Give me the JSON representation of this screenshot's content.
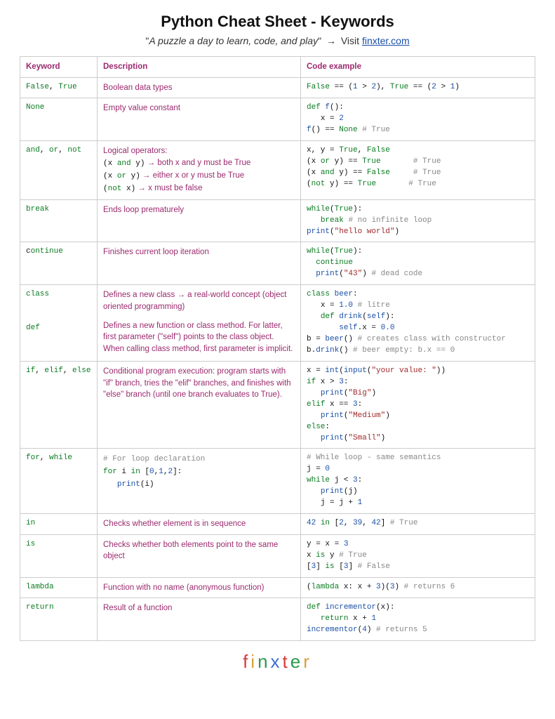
{
  "header": {
    "title": "Python Cheat Sheet - Keywords",
    "quote": "A puzzle a day to learn, code, and play",
    "visit_text": "Visit",
    "link_text": "finxter.com"
  },
  "table": {
    "columns": [
      "Keyword",
      "Description",
      "Code example"
    ]
  },
  "rows": [
    {
      "kw": [
        [
          "kw",
          "False"
        ],
        [
          "punc",
          ", "
        ],
        [
          "kw",
          "True"
        ]
      ],
      "desc": [
        {
          "t": "text",
          "v": "Boolean data types"
        }
      ],
      "code": [
        [
          "kw",
          "False"
        ],
        [
          "punc",
          " == ("
        ],
        [
          "num",
          "1"
        ],
        [
          "punc",
          " > "
        ],
        [
          "num",
          "2"
        ],
        [
          "punc",
          "), "
        ],
        [
          "kw",
          "True"
        ],
        [
          "punc",
          " == ("
        ],
        [
          "num",
          "2"
        ],
        [
          "punc",
          " > "
        ],
        [
          "num",
          "1"
        ],
        [
          "punc",
          ")"
        ]
      ]
    },
    {
      "kw": [
        [
          "kw",
          "None"
        ]
      ],
      "desc": [
        {
          "t": "text",
          "v": "Empty value constant"
        }
      ],
      "code": [
        [
          "kw",
          "def"
        ],
        [
          "punc",
          " "
        ],
        [
          "name",
          "f"
        ],
        [
          "punc",
          "():\n   x = "
        ],
        [
          "num",
          "2"
        ],
        [
          "punc",
          "\n"
        ],
        [
          "name",
          "f"
        ],
        [
          "punc",
          "() == "
        ],
        [
          "kw",
          "None"
        ],
        [
          "punc",
          " "
        ],
        [
          "cmt",
          "# True"
        ]
      ]
    },
    {
      "kw": [
        [
          "kw",
          "and"
        ],
        [
          "punc",
          ", "
        ],
        [
          "kw",
          "or"
        ],
        [
          "punc",
          ", "
        ],
        [
          "kw",
          "not"
        ]
      ],
      "desc": [
        {
          "t": "text",
          "v": "Logical operators:"
        },
        {
          "t": "br"
        },
        {
          "t": "code",
          "v": [
            [
              "punc",
              "(x "
            ],
            [
              "kw",
              "and"
            ],
            [
              "punc",
              " y)"
            ]
          ]
        },
        {
          "t": "text",
          "v": " → both x and y must be True"
        },
        {
          "t": "br"
        },
        {
          "t": "code",
          "v": [
            [
              "punc",
              "(x "
            ],
            [
              "kw",
              "or"
            ],
            [
              "punc",
              " y)"
            ]
          ]
        },
        {
          "t": "text",
          "v": " → either x or y must be True"
        },
        {
          "t": "br"
        },
        {
          "t": "code",
          "v": [
            [
              "punc",
              "("
            ],
            [
              "kw",
              "not"
            ],
            [
              "punc",
              " x)"
            ]
          ]
        },
        {
          "t": "text",
          "v": " → x must be false"
        }
      ],
      "code": [
        [
          "punc",
          "x, y = "
        ],
        [
          "kw",
          "True"
        ],
        [
          "punc",
          ", "
        ],
        [
          "kw",
          "False"
        ],
        [
          "punc",
          "\n(x "
        ],
        [
          "kw",
          "or"
        ],
        [
          "punc",
          " y) == "
        ],
        [
          "kw",
          "True"
        ],
        [
          "punc",
          "       "
        ],
        [
          "cmt",
          "# True"
        ],
        [
          "punc",
          "\n(x "
        ],
        [
          "kw",
          "and"
        ],
        [
          "punc",
          " y) == "
        ],
        [
          "kw",
          "False"
        ],
        [
          "punc",
          "     "
        ],
        [
          "cmt",
          "# True"
        ],
        [
          "punc",
          "\n("
        ],
        [
          "kw",
          "not"
        ],
        [
          "punc",
          " y) == "
        ],
        [
          "kw",
          "True"
        ],
        [
          "punc",
          "       "
        ],
        [
          "cmt",
          "# True"
        ]
      ]
    },
    {
      "kw": [
        [
          "kw",
          "break"
        ]
      ],
      "desc": [
        {
          "t": "text",
          "v": "Ends loop prematurely"
        }
      ],
      "code": [
        [
          "kw",
          "while"
        ],
        [
          "punc",
          "("
        ],
        [
          "kw",
          "True"
        ],
        [
          "punc",
          "):\n   "
        ],
        [
          "kw",
          "break"
        ],
        [
          "punc",
          " "
        ],
        [
          "cmt",
          "# no infinite loop"
        ],
        [
          "punc",
          "\n"
        ],
        [
          "name",
          "print"
        ],
        [
          "punc",
          "("
        ],
        [
          "str",
          "\"hello world\""
        ],
        [
          "punc",
          ")"
        ]
      ]
    },
    {
      "kw": [
        [
          "punc",
          "c"
        ],
        [
          "kw",
          "ontinue"
        ]
      ],
      "desc": [
        {
          "t": "text",
          "v": "Finishes current loop iteration"
        }
      ],
      "code": [
        [
          "kw",
          "while"
        ],
        [
          "punc",
          "("
        ],
        [
          "kw",
          "True"
        ],
        [
          "punc",
          "):\n  "
        ],
        [
          "kw",
          "continue"
        ],
        [
          "punc",
          "\n  "
        ],
        [
          "name",
          "print"
        ],
        [
          "punc",
          "("
        ],
        [
          "str",
          "\"43\""
        ],
        [
          "punc",
          ") "
        ],
        [
          "cmt",
          "# dead code"
        ]
      ]
    },
    {
      "kw": [
        [
          "kw",
          "class"
        ],
        [
          "punc",
          "\n\n\n"
        ],
        [
          "kw",
          "def"
        ]
      ],
      "desc": [
        {
          "t": "text",
          "v": "Defines a new class → a real-world concept (object oriented programming)"
        },
        {
          "t": "gap"
        },
        {
          "t": "text",
          "v": "Defines a new function or class method. For latter, first parameter (\"self\") points to the class object. When calling class method, first parameter is implicit."
        }
      ],
      "code": [
        [
          "kw",
          "class"
        ],
        [
          "punc",
          " "
        ],
        [
          "name",
          "beer"
        ],
        [
          "punc",
          ":\n   x = "
        ],
        [
          "num",
          "1.0"
        ],
        [
          "punc",
          " "
        ],
        [
          "cmt",
          "# litre"
        ],
        [
          "punc",
          "\n   "
        ],
        [
          "kw",
          "def"
        ],
        [
          "punc",
          " "
        ],
        [
          "name",
          "drink"
        ],
        [
          "punc",
          "("
        ],
        [
          "name",
          "self"
        ],
        [
          "punc",
          "):\n       "
        ],
        [
          "name",
          "self"
        ],
        [
          "punc",
          ".x = "
        ],
        [
          "num",
          "0.0"
        ],
        [
          "punc",
          "\nb = "
        ],
        [
          "name",
          "beer"
        ],
        [
          "punc",
          "() "
        ],
        [
          "cmt",
          "# creates class with constructor"
        ],
        [
          "punc",
          "\nb."
        ],
        [
          "name",
          "drink"
        ],
        [
          "punc",
          "() "
        ],
        [
          "cmt",
          "# beer empty: b.x == 0"
        ]
      ]
    },
    {
      "kw": [
        [
          "kw",
          "if"
        ],
        [
          "punc",
          ", "
        ],
        [
          "kw",
          "elif"
        ],
        [
          "punc",
          ", "
        ],
        [
          "kw",
          "else"
        ]
      ],
      "desc": [
        {
          "t": "text",
          "v": "Conditional program execution: program starts with \"if\" branch, tries the \"elif\" branches, and finishes with \"else\" branch (until one branch evaluates to True)."
        }
      ],
      "code": [
        [
          "punc",
          "x = "
        ],
        [
          "name",
          "int"
        ],
        [
          "punc",
          "("
        ],
        [
          "name",
          "input"
        ],
        [
          "punc",
          "("
        ],
        [
          "str",
          "\"your value: \""
        ],
        [
          "punc",
          "))\n"
        ],
        [
          "kw",
          "if"
        ],
        [
          "punc",
          " x > "
        ],
        [
          "num",
          "3"
        ],
        [
          "punc",
          ":\n   "
        ],
        [
          "name",
          "print"
        ],
        [
          "punc",
          "("
        ],
        [
          "str",
          "\"Big\""
        ],
        [
          "punc",
          ")\n"
        ],
        [
          "kw",
          "elif"
        ],
        [
          "punc",
          " x == "
        ],
        [
          "num",
          "3"
        ],
        [
          "punc",
          ":\n   "
        ],
        [
          "name",
          "print"
        ],
        [
          "punc",
          "("
        ],
        [
          "str",
          "\"Medium\""
        ],
        [
          "punc",
          ")\n"
        ],
        [
          "kw",
          "else"
        ],
        [
          "punc",
          ":\n   "
        ],
        [
          "name",
          "print"
        ],
        [
          "punc",
          "("
        ],
        [
          "str",
          "\"Small\""
        ],
        [
          "punc",
          ")"
        ]
      ]
    },
    {
      "kw": [
        [
          "kw",
          "for"
        ],
        [
          "punc",
          ", "
        ],
        [
          "kw",
          "while"
        ]
      ],
      "desc": [
        {
          "t": "code",
          "v": [
            [
              "cmt",
              "# For loop declaration"
            ],
            [
              "punc",
              "\n"
            ],
            [
              "kw",
              "for"
            ],
            [
              "punc",
              " i "
            ],
            [
              "kw",
              "in"
            ],
            [
              "punc",
              " ["
            ],
            [
              "num",
              "0"
            ],
            [
              "punc",
              ","
            ],
            [
              "num",
              "1"
            ],
            [
              "punc",
              ","
            ],
            [
              "num",
              "2"
            ],
            [
              "punc",
              "]:\n   "
            ],
            [
              "name",
              "print"
            ],
            [
              "punc",
              "(i)"
            ]
          ]
        }
      ],
      "code": [
        [
          "cmt",
          "# While loop - same semantics"
        ],
        [
          "punc",
          "\nj = "
        ],
        [
          "num",
          "0"
        ],
        [
          "punc",
          "\n"
        ],
        [
          "kw",
          "while"
        ],
        [
          "punc",
          " j < "
        ],
        [
          "num",
          "3"
        ],
        [
          "punc",
          ":\n   "
        ],
        [
          "name",
          "print"
        ],
        [
          "punc",
          "(j)\n   j = j + "
        ],
        [
          "num",
          "1"
        ]
      ]
    },
    {
      "kw": [
        [
          "kw",
          "in"
        ]
      ],
      "desc": [
        {
          "t": "text",
          "v": "Checks whether element is in sequence"
        }
      ],
      "code": [
        [
          "num",
          "42"
        ],
        [
          "punc",
          " "
        ],
        [
          "kw",
          "in"
        ],
        [
          "punc",
          " ["
        ],
        [
          "num",
          "2"
        ],
        [
          "punc",
          ", "
        ],
        [
          "num",
          "39"
        ],
        [
          "punc",
          ", "
        ],
        [
          "num",
          "42"
        ],
        [
          "punc",
          "] "
        ],
        [
          "cmt",
          "# True"
        ]
      ]
    },
    {
      "kw": [
        [
          "kw",
          "is"
        ]
      ],
      "desc": [
        {
          "t": "text",
          "v": "Checks whether both elements point to the same object"
        }
      ],
      "code": [
        [
          "punc",
          "y = x = "
        ],
        [
          "num",
          "3"
        ],
        [
          "punc",
          "\nx "
        ],
        [
          "kw",
          "is"
        ],
        [
          "punc",
          " y "
        ],
        [
          "cmt",
          "# True"
        ],
        [
          "punc",
          "\n["
        ],
        [
          "num",
          "3"
        ],
        [
          "punc",
          "] "
        ],
        [
          "kw",
          "is"
        ],
        [
          "punc",
          " ["
        ],
        [
          "num",
          "3"
        ],
        [
          "punc",
          "] "
        ],
        [
          "cmt",
          "# False"
        ]
      ]
    },
    {
      "kw": [
        [
          "kw",
          "lambda"
        ]
      ],
      "desc": [
        {
          "t": "text",
          "v": "Function with no name (anonymous function)"
        }
      ],
      "code": [
        [
          "punc",
          "("
        ],
        [
          "kw",
          "lambda"
        ],
        [
          "punc",
          " x: x + "
        ],
        [
          "num",
          "3"
        ],
        [
          "punc",
          ")("
        ],
        [
          "num",
          "3"
        ],
        [
          "punc",
          ") "
        ],
        [
          "cmt",
          "# returns 6"
        ]
      ]
    },
    {
      "kw": [
        [
          "kw",
          "return"
        ]
      ],
      "desc": [
        {
          "t": "text",
          "v": "Result of a function"
        }
      ],
      "code": [
        [
          "kw",
          "def"
        ],
        [
          "punc",
          " "
        ],
        [
          "name",
          "incrementor"
        ],
        [
          "punc",
          "(x):\n   "
        ],
        [
          "kw",
          "return"
        ],
        [
          "punc",
          " x + "
        ],
        [
          "num",
          "1"
        ],
        [
          "punc",
          "\n"
        ],
        [
          "name",
          "incrementor"
        ],
        [
          "punc",
          "("
        ],
        [
          "num",
          "4"
        ],
        [
          "punc",
          ") "
        ],
        [
          "cmt",
          "# returns 5"
        ]
      ]
    }
  ],
  "logo": "finxter"
}
